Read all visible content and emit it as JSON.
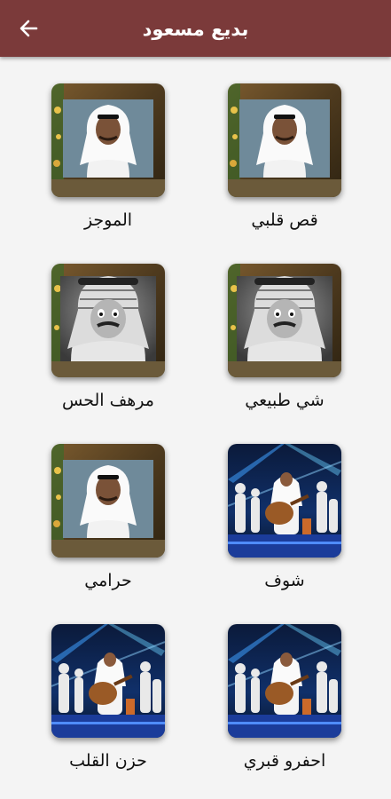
{
  "header": {
    "title": "بديع مسعود",
    "back_icon": "arrow-left-icon",
    "background": "#7b3a3a"
  },
  "songs": [
    {
      "title": "قص قلبي",
      "thumbnail": "portrait-ghutra-white"
    },
    {
      "title": "الموجز",
      "thumbnail": "portrait-ghutra-white"
    },
    {
      "title": "شي طبيعي",
      "thumbnail": "portrait-shemagh-black-white"
    },
    {
      "title": "مرهف الحس",
      "thumbnail": "portrait-shemagh-black-white"
    },
    {
      "title": "شوف",
      "thumbnail": "stage-concert-oud"
    },
    {
      "title": "حرامي",
      "thumbnail": "portrait-ghutra-white"
    },
    {
      "title": "احفرو قبري",
      "thumbnail": "stage-concert-oud"
    },
    {
      "title": "حزن القلب",
      "thumbnail": "stage-concert-oud"
    }
  ]
}
